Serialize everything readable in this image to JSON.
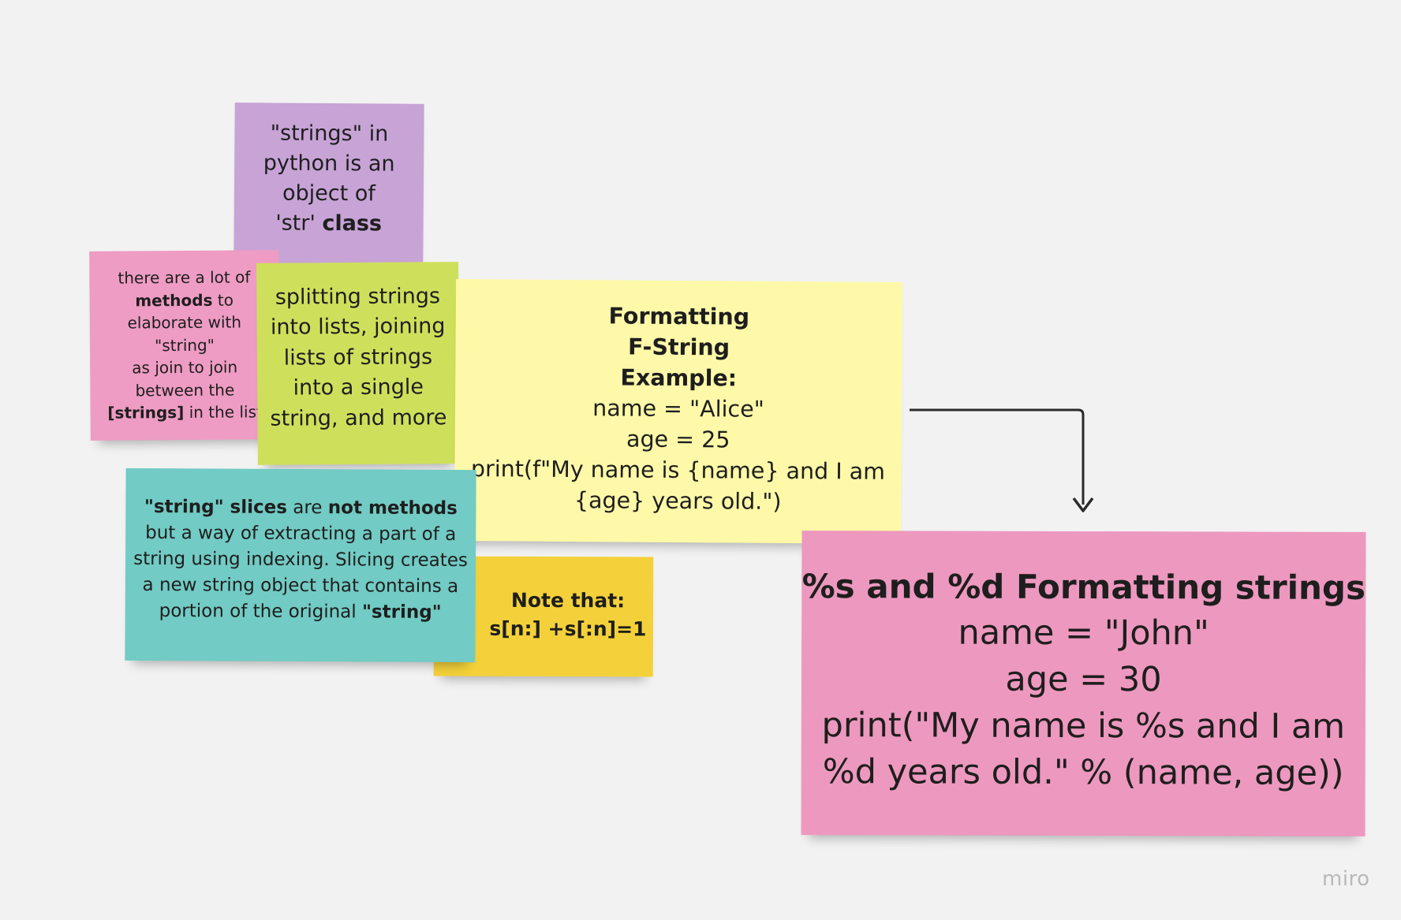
{
  "notes": {
    "strings_object": {
      "color": "#c7a3d6",
      "lines": [
        "\"strings\" in",
        "python is an",
        "object of"
      ],
      "last_line_plain": "'str' ",
      "last_line_bold": "class"
    },
    "methods": {
      "color": "#ee9cc3",
      "line1": "there are a lot of",
      "line2_bold": "methods",
      "line2_plain": " to",
      "line3": "elaborate with",
      "line4": "\"string\"",
      "line5": "as join to join",
      "line6": "between  the",
      "line7_bold": "[strings]",
      "line7_plain": " in the list"
    },
    "splitting": {
      "color": "#cee05b",
      "lines": [
        "splitting strings",
        "into lists, joining",
        "lists of strings",
        "into a single",
        "string, and more"
      ]
    },
    "fstring": {
      "color": "#fef9a8",
      "title_lines": [
        "Formatting",
        "F-String",
        "Example:"
      ],
      "code_lines": [
        "name = \"Alice\"",
        "age = 25",
        "print(f\"My name is {name} and I am",
        "{age} years old.\")"
      ]
    },
    "slices": {
      "color": "#72cbc4",
      "l1_bold_a": "\"string\"  slices",
      "l1_plain": " are ",
      "l1_bold_b": "not methods",
      "l2": "but a way of extracting a part of a",
      "l3": "string using indexing. Slicing creates",
      "l4": "a new string object that contains a",
      "l5_plain": "portion of the original ",
      "l5_bold": "\"string\""
    },
    "note_that": {
      "color": "#f4d13a",
      "lines": [
        "Note that:",
        "s[n:] +s[:n]=1"
      ]
    },
    "percent_format": {
      "color": "#ed98bf",
      "title": "%s and %d Formatting strings",
      "lines": [
        "name = \"John\"",
        "age = 30",
        "print(\"My name is %s and I am",
        "%d years old.\" % (name, age))"
      ]
    }
  },
  "watermark": "miro"
}
